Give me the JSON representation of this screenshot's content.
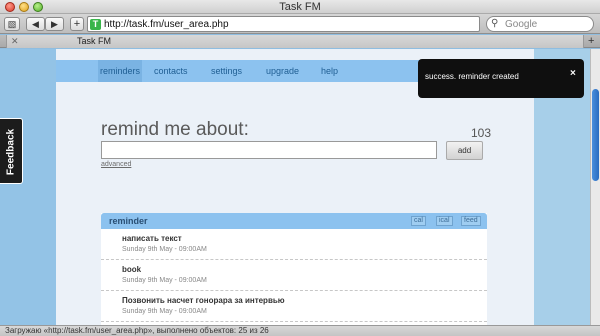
{
  "window": {
    "title": "Task FM"
  },
  "toolbar": {
    "url": "http://task.fm/user_area.php",
    "favicon_letter": "T",
    "search_placeholder": "Google",
    "back_icon": "back-arrow-icon",
    "forward_icon": "forward-arrow-icon",
    "add_bookmark": "+"
  },
  "tabs": [
    {
      "label": "Task FM"
    }
  ],
  "nav": {
    "items": [
      "reminders",
      "contacts",
      "settings",
      "upgrade",
      "help"
    ],
    "active": "reminders"
  },
  "form": {
    "heading": "remind me about:",
    "counter": "103",
    "input_value": "",
    "add_label": "add",
    "advanced_label": "advanced"
  },
  "reminders": {
    "title": "reminder",
    "tags": [
      "cal",
      "ical",
      "feed"
    ],
    "items": [
      {
        "title": "написать текст",
        "date": "Sunday 9th May - 09:00AM"
      },
      {
        "title": "book",
        "date": "Sunday 9th May - 09:00AM"
      },
      {
        "title": "Позвонить насчет гонорара за интервью",
        "date": "Sunday 9th May - 09:00AM"
      }
    ]
  },
  "feedback": {
    "label": "Feedback"
  },
  "notification": {
    "message": "success. reminder created",
    "close": "×"
  },
  "status": {
    "text": "Загружаю «http://task.fm/user_area.php», выполнено объектов: 25 из 26"
  },
  "colors": {
    "nav": "#8cc2ef",
    "page_bg": "#93c3e6",
    "toast": "#0f0f0f"
  }
}
